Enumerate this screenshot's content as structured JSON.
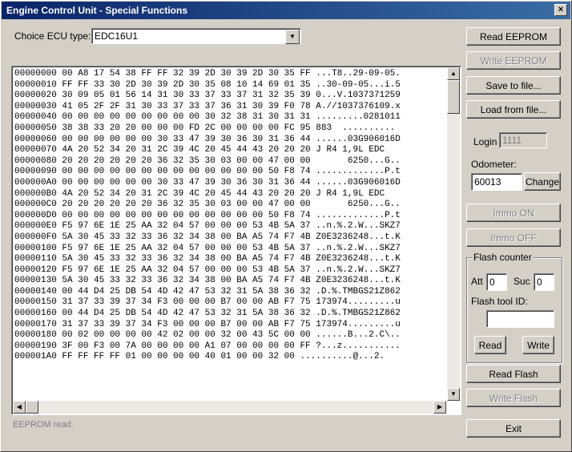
{
  "window": {
    "title": "Engine Control Unit - Special Functions",
    "close_symbol": "×"
  },
  "ecu": {
    "label": "Choice ECU type:",
    "selected": "EDC16U1"
  },
  "hex_lines": [
    "00000000 00 A8 17 54 38 FF FF 32 39 2D 30 39 2D 30 35 FF ...T8..29-09-05.",
    "00000010 FF FF 33 30 2D 30 39 2D 30 35 08 10 14 69 01 35 ..30-09-05...i.5",
    "00000020 30 09 05 01 56 14 31 30 33 37 33 37 31 32 35 39 0...V.1037371259",
    "00000030 41 05 2F 2F 31 30 33 37 33 37 36 31 30 39 F0 78 A.//1037376109.x",
    "00000040 00 00 00 00 00 00 00 00 00 30 32 38 31 30 31 31 .........0281011",
    "00000050 38 38 33 20 20 00 00 00 FD 2C 00 00 00 00 FC 95 883  ..........",
    "00000060 00 00 00 00 00 00 30 33 47 39 30 36 30 31 36 44 ......03G906016D",
    "00000070 4A 20 52 34 20 31 2C 39 4C 20 45 44 43 20 20 20 J R4 1,9L EDC",
    "00000080 20 20 20 20 20 20 36 32 35 30 03 00 00 47 00 00       6250...G..",
    "00000090 00 00 00 00 00 00 00 00 00 00 00 00 00 50 F8 74 .............P.t",
    "000000A0 00 00 00 00 00 00 30 33 47 39 30 36 30 31 36 44 ......03G906016D",
    "000000B0 4A 20 52 34 20 31 2C 39 4C 20 45 44 43 20 20 20 J R4 1,9L EDC",
    "000000C0 20 20 20 20 20 20 36 32 35 30 03 00 00 47 00 00       6250...G..",
    "000000D0 00 00 00 00 00 00 00 00 00 00 00 00 00 50 F8 74 .............P.t",
    "000000E0 F5 97 6E 1E 25 AA 32 04 57 00 00 00 53 4B 5A 37 ..n.%.2.W...SKZ7",
    "000000F0 5A 30 45 33 32 33 36 32 34 38 00 BA A5 74 F7 4B Z0E3236248...t.K",
    "00000100 F5 97 6E 1E 25 AA 32 04 57 00 00 00 53 4B 5A 37 ..n.%.2.W...SKZ7",
    "00000110 5A 30 45 33 32 33 36 32 34 38 00 BA A5 74 F7 4B Z0E3236248...t.K",
    "00000120 F5 97 6E 1E 25 AA 32 04 57 00 00 00 53 4B 5A 37 ..n.%.2.W...SKZ7",
    "00000130 5A 30 45 33 32 33 36 32 34 38 00 BA A5 74 F7 4B Z0E3236248...t.K",
    "00000140 00 44 D4 25 DB 54 4D 42 47 53 32 31 5A 38 36 32 .D.%.TMBGS21Z862",
    "00000150 31 37 33 39 37 34 F3 00 00 00 B7 00 00 AB F7 75 173974.........u",
    "00000160 00 44 D4 25 DB 54 4D 42 47 53 32 31 5A 38 36 32 .D.%.TMBGS21Z862",
    "00000170 31 37 33 39 37 34 F3 00 00 00 B7 00 00 AB F7 75 173974.........u",
    "00000180 00 02 00 00 00 00 42 02 00 00 32 00 43 5C 00 00 ......B...2.C\\..",
    "00000190 3F 00 F3 00 7A 00 00 00 00 A1 07 00 00 00 00 FF ?...z...........",
    "000001A0 FF FF FF FF 01 00 00 00 00 40 01 00 00 32 00 ..........@...2."
  ],
  "buttons": {
    "read_eeprom": "Read EEPROM",
    "write_eeprom": "Write EEPROM",
    "save_to_file": "Save to file...",
    "load_from_file": "Load from file...",
    "change": "Change",
    "immo_on": "Immo ON",
    "immo_off": "Immo OFF",
    "read": "Read",
    "write": "Write",
    "read_flash": "Read Flash",
    "write_flash": "Write Flash",
    "exit": "Exit"
  },
  "login": {
    "label": "Login",
    "value": "1111"
  },
  "odometer": {
    "label": "Odometer:",
    "value": "60013"
  },
  "flash_counter": {
    "title": "Flash counter",
    "att_label": "Att",
    "att_value": "0",
    "suc_label": "Suc",
    "suc_value": "0",
    "tool_id_label": "Flash tool ID:",
    "tool_id_value": ""
  },
  "status": {
    "text": "EEPROM read."
  },
  "icons": {
    "arrow_down": "▼",
    "arrow_up": "▲",
    "arrow_left": "◀",
    "arrow_right": "▶"
  }
}
